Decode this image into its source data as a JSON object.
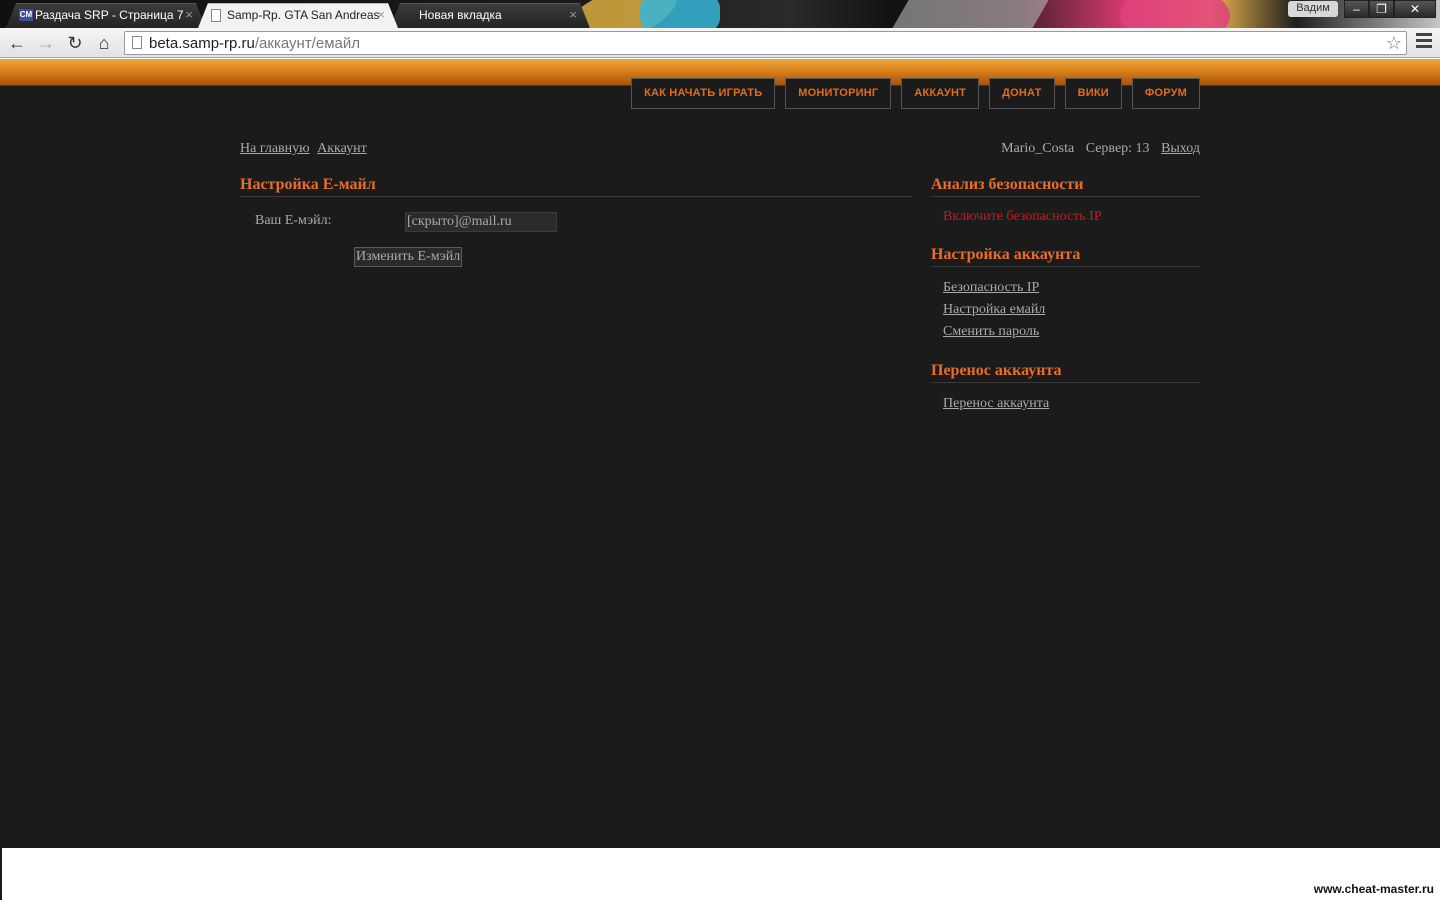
{
  "browser": {
    "tabs": [
      {
        "title": "Раздача SRP - Страница 7",
        "favicon": "CM",
        "active": false
      },
      {
        "title": "Samp-Rp. GTA San Andreas",
        "favicon": "page-icon",
        "active": true
      },
      {
        "title": "Новая вкладка",
        "favicon": "",
        "active": false
      }
    ],
    "profile_name": "Вадим",
    "window_controls": {
      "minimize": "‒",
      "restore": "❐",
      "close": "✕"
    },
    "address": {
      "host": "beta.samp-rp.ru",
      "path": "/аккаунт/емайл"
    },
    "nav_icons": {
      "back": "←",
      "forward": "→",
      "reload": "↻",
      "home": "⌂",
      "star": "☆"
    }
  },
  "site": {
    "colors": {
      "accent": "#e86d2a",
      "alert": "#cc1b1b",
      "background": "#1b1b1b",
      "text": "#aaaaaa"
    },
    "topnav": [
      "КАК НАЧАТЬ ИГРАТЬ",
      "МОНИТОРИНГ",
      "АККАУНТ",
      "ДОНАТ",
      "ВИКИ",
      "ФОРУМ"
    ],
    "breadcrumb": [
      "На главную",
      "Аккаунт"
    ],
    "user": {
      "name": "Mario_Costa",
      "server": "Сервер: 13",
      "logout": "Выход"
    }
  },
  "main": {
    "title": "Настройка Е-майл",
    "email_label": "Ваш Е-мэйл:",
    "email_value": "[скрыто]@mail.ru",
    "submit_label": "Изменить Е-мэйл"
  },
  "sidebar": {
    "security": {
      "title": "Анализ безопасности",
      "alert": "Включите безопасность IP"
    },
    "settings": {
      "title": "Настройка аккаунта",
      "links": [
        "Безопасность IP",
        "Настройка емайл",
        "Сменить пароль"
      ]
    },
    "transfer": {
      "title": "Перенос аккаунта",
      "links": [
        "Перенос аккаунта"
      ]
    }
  },
  "watermark": "www.cheat-master.ru"
}
